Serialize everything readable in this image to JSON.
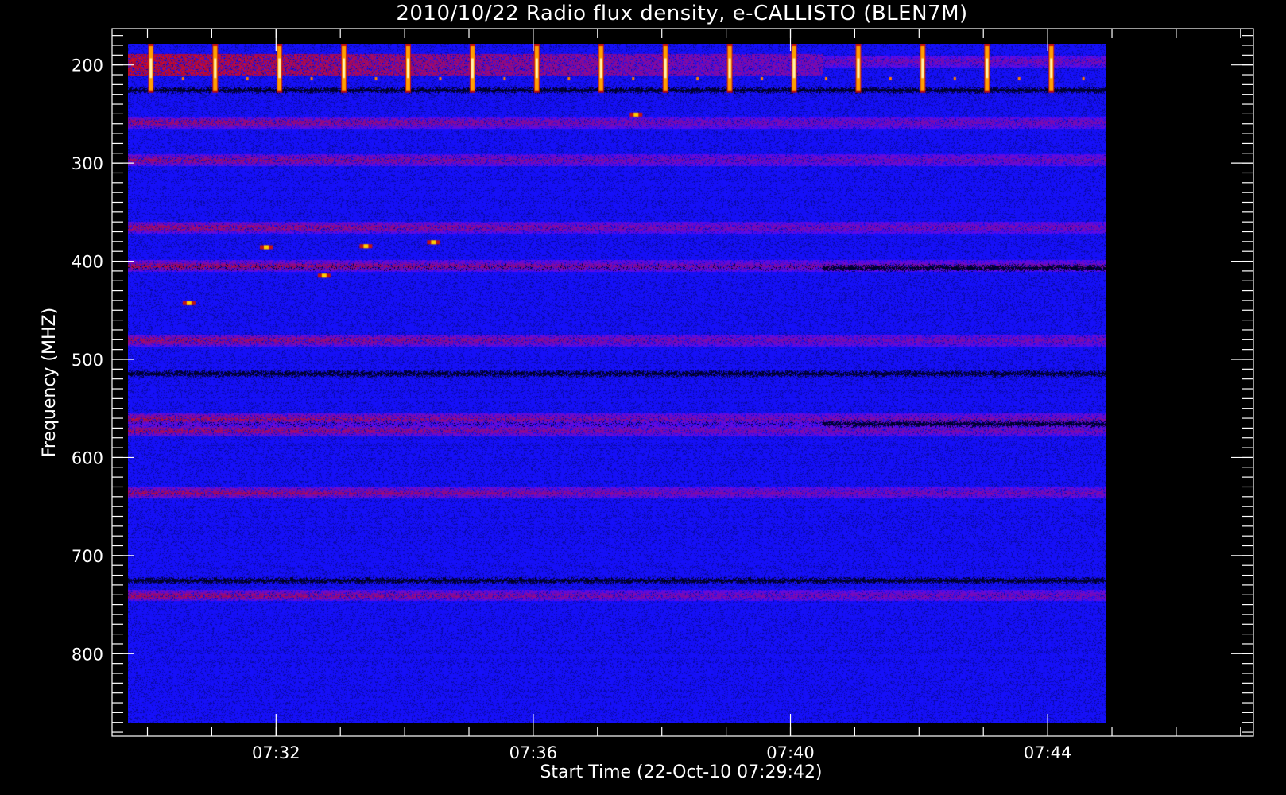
{
  "chart_data": {
    "type": "heatmap",
    "title": "2010/10/22  Radio flux density, e-CALLISTO (BLEN7M)",
    "xlabel": "Start Time (22-Oct-10 07:29:42)",
    "ylabel": "Frequency (MHZ)",
    "x_tick_labels": [
      "07:32",
      "07:36",
      "07:40",
      "07:44"
    ],
    "x_tick_minutes": [
      32,
      36,
      40,
      44
    ],
    "y_tick_labels": [
      "200",
      "300",
      "400",
      "500",
      "600",
      "700",
      "800"
    ],
    "y_tick_values": [
      200,
      300,
      400,
      500,
      600,
      700,
      800
    ],
    "xlim_minutes": [
      29.45,
      47.2
    ],
    "data_time_range_minutes": [
      29.7,
      44.9
    ],
    "ylim": [
      884,
      163
    ],
    "data_freq_range": [
      178,
      870
    ],
    "y_inverted": true,
    "colormap": {
      "background": "#1a12ff",
      "low": "#000000",
      "mid": "#a01020",
      "high": "#ffe000"
    },
    "features": {
      "periodic_spike_minutes": [
        30.05,
        31.05,
        32.05,
        33.05,
        34.05,
        35.05,
        36.05,
        37.05,
        38.05,
        39.05,
        40.05,
        41.05,
        42.05,
        43.05,
        44.05
      ],
      "periodic_spike_freq_range": [
        178,
        228
      ],
      "bright_band_freq_range": [
        188,
        210
      ],
      "red_band_freqs": [
        196,
        258,
        296,
        365,
        404,
        480,
        560,
        572,
        635,
        740
      ],
      "dark_band_freqs": [
        225,
        406,
        514,
        565,
        725
      ],
      "isolated_bursts": [
        {
          "minute": 30.65,
          "freq": 442
        },
        {
          "minute": 31.85,
          "freq": 385
        },
        {
          "minute": 32.75,
          "freq": 414
        },
        {
          "minute": 33.4,
          "freq": 384
        },
        {
          "minute": 34.45,
          "freq": 380
        },
        {
          "minute": 37.6,
          "freq": 250
        }
      ]
    }
  }
}
